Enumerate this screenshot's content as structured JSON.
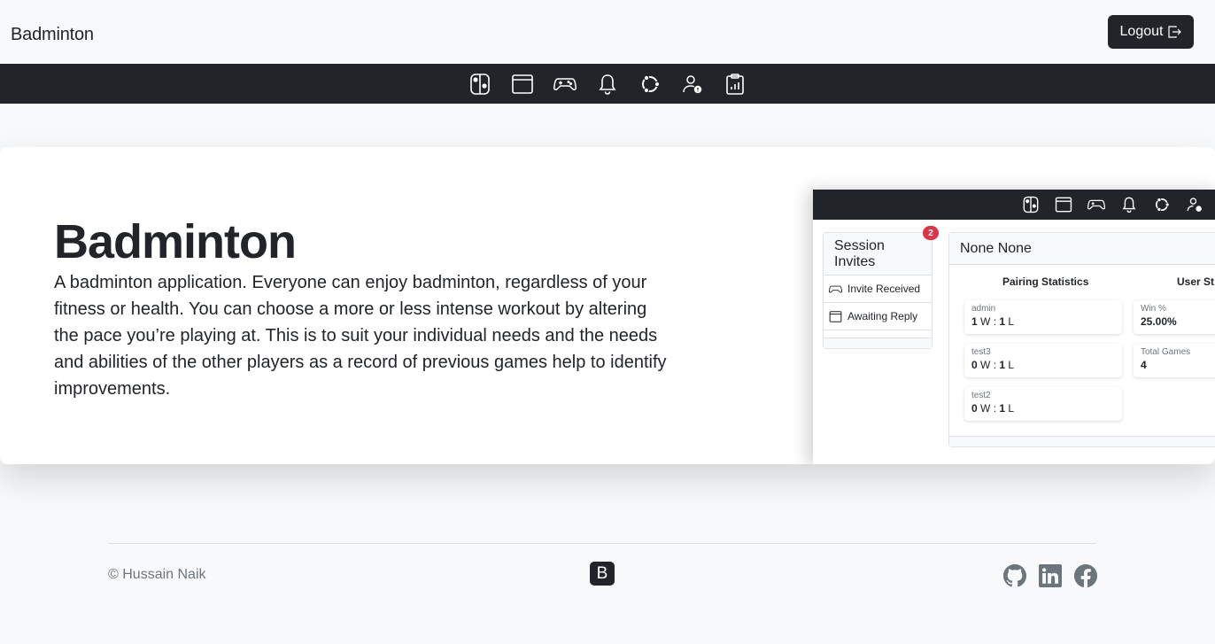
{
  "header": {
    "brand": "Badminton",
    "logout_label": "Logout"
  },
  "nav": {
    "icons": [
      "nintendo-switch-icon",
      "calendar-window-icon",
      "controller-icon",
      "bell-icon",
      "ubuntu-icon",
      "person-exclamation-icon",
      "clipboard-data-icon"
    ]
  },
  "hero": {
    "title": "Badminton",
    "text": "A badminton application. Everyone can enjoy badminton, regardless of your fitness or health. You can choose a more or less intense workout by altering the pace you’re playing at. This is to suit your individual needs and the needs and abilities of the other players as a record of previous games help to identify improvements."
  },
  "preview": {
    "invites": {
      "title": "Session Invites",
      "badge": "2",
      "items": [
        "Invite Received",
        "Awaiting Reply"
      ]
    },
    "stats": {
      "title": "None None",
      "pairing_title": "Pairing Statistics",
      "user_title": "User St",
      "pairings": [
        {
          "name": "admin",
          "wins": "1",
          "losses": "1"
        },
        {
          "name": "test3",
          "wins": "0",
          "losses": "1"
        },
        {
          "name": "test2",
          "wins": "0",
          "losses": "1"
        }
      ],
      "w_label": "W :",
      "l_label": "L",
      "user_stats": [
        {
          "label": "Win %",
          "value": "25.00%"
        },
        {
          "label": "Total Games",
          "value": "4"
        }
      ]
    }
  },
  "footer": {
    "copyright": "© Hussain Naik",
    "logo_letter": "B",
    "social": [
      "github-icon",
      "linkedin-icon",
      "facebook-icon"
    ]
  },
  "colors": {
    "dark": "#212529",
    "light": "#f8f9fa",
    "badge": "#dc3545",
    "muted": "#6c757d"
  }
}
